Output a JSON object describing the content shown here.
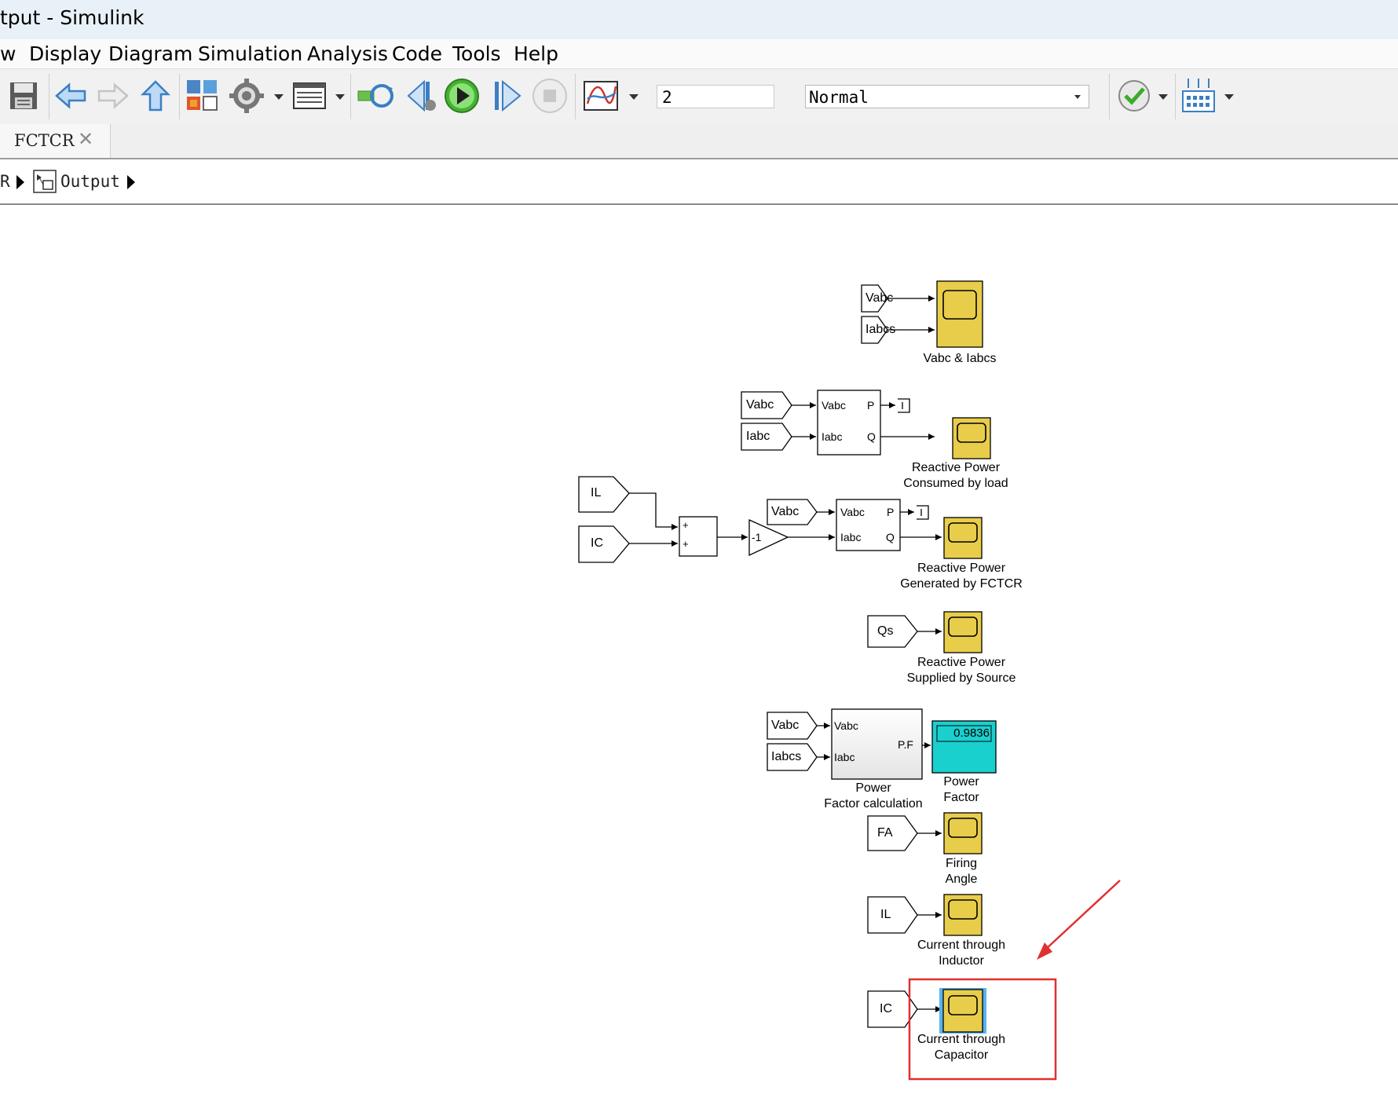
{
  "window": {
    "title": "tput - Simulink"
  },
  "menu": [
    "w",
    "Display",
    "Diagram",
    "Simulation",
    "Analysis",
    "Code",
    "Tools",
    "Help"
  ],
  "toolbar": {
    "stop_time": "2",
    "sim_mode": "Normal",
    "icons": [
      "save-icon",
      "back-arrow-icon",
      "forward-arrow-icon",
      "up-arrow-icon",
      "library-browser-icon",
      "model-settings-icon",
      "model-explorer-icon",
      "update-model-icon",
      "step-back-icon",
      "run-icon",
      "step-forward-icon",
      "stop-icon",
      "data-inspector-icon",
      "check-icon",
      "signal-logging-icon"
    ]
  },
  "tab": {
    "label": "FCTCR",
    "close": "✕"
  },
  "breadcrumb": {
    "prefix": "R",
    "current": "Output"
  },
  "diagram": {
    "goto_tags": {
      "vabc1": "Vabc",
      "iabcs1": "Iabcs",
      "vabc2": "Vabc",
      "iabc2": "Iabc",
      "il1": "IL",
      "ic1": "IC",
      "vabc3": "Vabc",
      "qs": "Qs",
      "vabc4": "Vabc",
      "iabcs4": "Iabcs",
      "fa": "FA",
      "il2": "IL",
      "ic2": "IC"
    },
    "pq_block_1": {
      "in1": "Vabc",
      "in2": "Iabc",
      "out1": "P",
      "out2": "Q"
    },
    "pq_block_2": {
      "in1": "Vabc",
      "in2": "Iabc",
      "out1": "P",
      "out2": "Q"
    },
    "sum_block": {
      "sign1": "+",
      "sign2": "+"
    },
    "gain_block": {
      "value": "-1"
    },
    "pf_block": {
      "in1": "Vabc",
      "in2": "Iabc",
      "out": "P.F",
      "label1": "Power",
      "label2": "Factor calculation"
    },
    "display_block": {
      "value": "0.9836",
      "label1": "Power",
      "label2": "Factor"
    },
    "scopes": {
      "s1": [
        "Vabc & Iabcs"
      ],
      "s2": [
        "Reactive Power",
        "Consumed by load"
      ],
      "s3": [
        "Reactive Power",
        "Generated by FCTCR"
      ],
      "s4": [
        "Reactive Power",
        "Supplied by Source"
      ],
      "s5": [
        "Firing",
        "Angle"
      ],
      "s6": [
        "Current through",
        "Inductor"
      ],
      "s7": [
        "Current through",
        "Capacitor"
      ]
    },
    "colors": {
      "scope": "#e8cd4b",
      "display": "#19d0cf",
      "highlight": "#e03030",
      "selection": "#56b4f0"
    }
  }
}
